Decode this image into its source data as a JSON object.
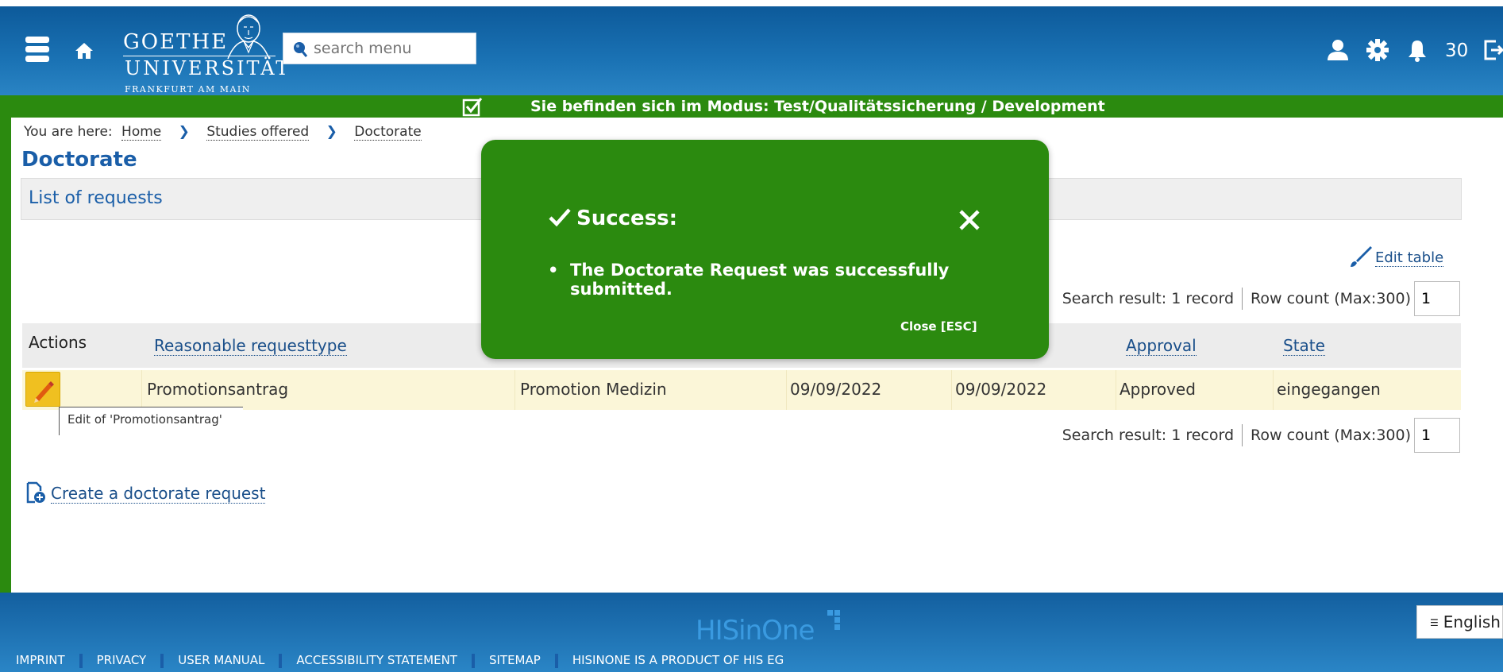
{
  "header": {
    "logo": {
      "line1": "GOETHE",
      "line2": "UNIVERSITÄT",
      "line3": "FRANKFURT AM MAIN"
    },
    "search_placeholder": "search menu",
    "notification_count": "30"
  },
  "mode_bar": {
    "text": "Sie befinden sich im Modus: Test/Qualitätssicherung / Development"
  },
  "breadcrumb": {
    "prefix": "You are here:",
    "items": [
      "Home",
      "Studies offered",
      "Doctorate"
    ]
  },
  "page_title": "Doctorate",
  "panel_title": "List of requests",
  "edit_table_label": "Edit table",
  "results": {
    "search_result": "Search result: 1 record",
    "row_count_label": "Row count (Max:300)",
    "row_count_value": "1"
  },
  "table": {
    "headers": [
      "Actions",
      "Reasonable requesttype",
      "Approval",
      "State"
    ],
    "rows": [
      {
        "type": "Promotionsantrag",
        "program": "Promotion Medizin",
        "date1": "09/09/2022",
        "date2": "09/09/2022",
        "approval": "Approved",
        "state": "eingegangen"
      }
    ],
    "edit_tooltip": "Edit of 'Promotionsantrag'"
  },
  "create_link": "Create a doctorate request",
  "modal": {
    "title": "Success:",
    "message": "The Doctorate Request was successfully submitted.",
    "close_label": "Close [ESC]"
  },
  "footer": {
    "brand": "HISinOne",
    "links": [
      "IMPRINT",
      "PRIVACY",
      "USER MANUAL",
      "ACCESSIBILITY STATEMENT",
      "SITEMAP",
      "HISINONE IS A PRODUCT OF HIS EG"
    ],
    "language": "English"
  },
  "colors": {
    "header_blue": "#1a72b4",
    "mode_green": "#2b8a0f",
    "link_blue": "#1a4f8a",
    "row_highlight": "#fbf6d8"
  }
}
